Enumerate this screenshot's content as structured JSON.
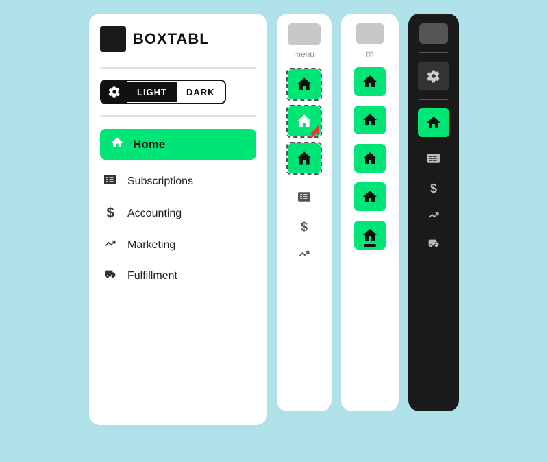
{
  "app": {
    "logo_text": "BOXTABL"
  },
  "theme": {
    "light_label": "LIGHT",
    "dark_label": "DARK"
  },
  "nav": {
    "home_label": "Home",
    "items": [
      {
        "label": "Subscriptions",
        "icon": "subscriptions"
      },
      {
        "label": "Accounting",
        "icon": "dollar"
      },
      {
        "label": "Marketing",
        "icon": "trending"
      },
      {
        "label": "Fulfillment",
        "icon": "truck"
      }
    ]
  },
  "panel1": {
    "menu_label": "menu"
  },
  "panel2": {
    "menu_label": "m"
  }
}
